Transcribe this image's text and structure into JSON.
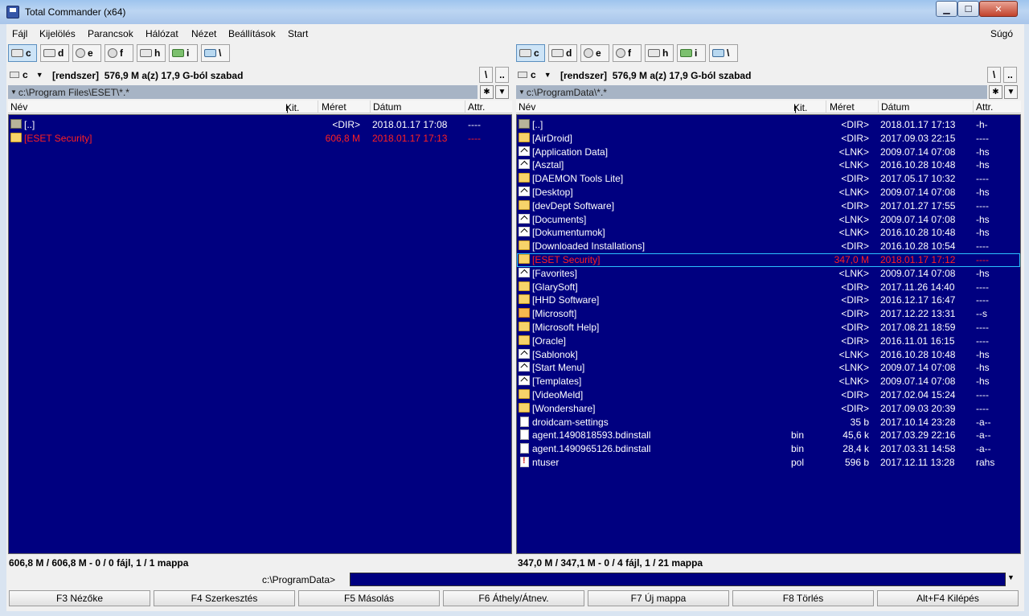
{
  "window": {
    "title": "Total Commander (x64)",
    "min_glyph": "▁",
    "max_glyph": "☐",
    "close_glyph": "✕"
  },
  "menu": {
    "items": [
      "Fájl",
      "Kijelölés",
      "Parancsok",
      "Hálózat",
      "Nézet",
      "Beállítások",
      "Start"
    ],
    "help": "Súgó"
  },
  "drives": [
    "c",
    "d",
    "e",
    "f",
    "h",
    "i",
    "\\"
  ],
  "left": {
    "drive": "c",
    "drive_label": "[rendszer]",
    "free_space": "576,9 M a(z) 17,9 G-ból szabad",
    "root_label": "\\",
    "up_label": "..",
    "path": "c:\\Program Files\\ESET\\*.*",
    "status": "606,8 M / 606,8 M - 0 / 0 fájl, 1 / 1 mappa",
    "rows": [
      {
        "icon": "up",
        "name": "[..]",
        "ext": "",
        "size": "<DIR>",
        "date": "2018.01.17 17:08",
        "attr": "----",
        "red": false
      },
      {
        "icon": "folder",
        "name": "[ESET Security]",
        "ext": "",
        "size": "606,8 M",
        "date": "2018.01.17 17:13",
        "attr": "----",
        "red": true
      }
    ]
  },
  "right": {
    "drive": "c",
    "drive_label": "[rendszer]",
    "free_space": "576,9 M a(z) 17,9 G-ból szabad",
    "root_label": "\\",
    "up_label": "..",
    "path": "c:\\ProgramData\\*.*",
    "status": "347,0 M / 347,1 M - 0 / 4 fájl, 1 / 21 mappa",
    "rows": [
      {
        "icon": "up",
        "name": "[..]",
        "ext": "",
        "size": "<DIR>",
        "date": "2018.01.17 17:13",
        "attr": "-h-",
        "red": false
      },
      {
        "icon": "folder",
        "name": "[AirDroid]",
        "ext": "",
        "size": "<DIR>",
        "date": "2017.09.03 22:15",
        "attr": "----",
        "red": false
      },
      {
        "icon": "link",
        "name": "[Application Data]",
        "ext": "",
        "size": "<LNK>",
        "date": "2009.07.14 07:08",
        "attr": "-hs",
        "red": false
      },
      {
        "icon": "link",
        "name": "[Asztal]",
        "ext": "",
        "size": "<LNK>",
        "date": "2016.10.28 10:48",
        "attr": "-hs",
        "red": false
      },
      {
        "icon": "folder",
        "name": "[DAEMON Tools Lite]",
        "ext": "",
        "size": "<DIR>",
        "date": "2017.05.17 10:32",
        "attr": "----",
        "red": false
      },
      {
        "icon": "link",
        "name": "[Desktop]",
        "ext": "",
        "size": "<LNK>",
        "date": "2009.07.14 07:08",
        "attr": "-hs",
        "red": false
      },
      {
        "icon": "folder",
        "name": "[devDept Software]",
        "ext": "",
        "size": "<DIR>",
        "date": "2017.01.27 17:55",
        "attr": "----",
        "red": false
      },
      {
        "icon": "link",
        "name": "[Documents]",
        "ext": "",
        "size": "<LNK>",
        "date": "2009.07.14 07:08",
        "attr": "-hs",
        "red": false
      },
      {
        "icon": "link",
        "name": "[Dokumentumok]",
        "ext": "",
        "size": "<LNK>",
        "date": "2016.10.28 10:48",
        "attr": "-hs",
        "red": false
      },
      {
        "icon": "folder",
        "name": "[Downloaded Installations]",
        "ext": "",
        "size": "<DIR>",
        "date": "2016.10.28 10:54",
        "attr": "----",
        "red": false
      },
      {
        "icon": "folder",
        "name": "[ESET Security]",
        "ext": "",
        "size": "347,0 M",
        "date": "2018.01.17 17:12",
        "attr": "----",
        "red": true,
        "cursor": true
      },
      {
        "icon": "link",
        "name": "[Favorites]",
        "ext": "",
        "size": "<LNK>",
        "date": "2009.07.14 07:08",
        "attr": "-hs",
        "red": false
      },
      {
        "icon": "folder",
        "name": "[GlarySoft]",
        "ext": "",
        "size": "<DIR>",
        "date": "2017.11.26 14:40",
        "attr": "----",
        "red": false
      },
      {
        "icon": "folder",
        "name": "[HHD Software]",
        "ext": "",
        "size": "<DIR>",
        "date": "2016.12.17 16:47",
        "attr": "----",
        "red": false
      },
      {
        "icon": "warn",
        "name": "[Microsoft]",
        "ext": "",
        "size": "<DIR>",
        "date": "2017.12.22 13:31",
        "attr": "--s",
        "red": false
      },
      {
        "icon": "folder",
        "name": "[Microsoft Help]",
        "ext": "",
        "size": "<DIR>",
        "date": "2017.08.21 18:59",
        "attr": "----",
        "red": false
      },
      {
        "icon": "folder",
        "name": "[Oracle]",
        "ext": "",
        "size": "<DIR>",
        "date": "2016.11.01 16:15",
        "attr": "----",
        "red": false
      },
      {
        "icon": "link",
        "name": "[Sablonok]",
        "ext": "",
        "size": "<LNK>",
        "date": "2016.10.28 10:48",
        "attr": "-hs",
        "red": false
      },
      {
        "icon": "link",
        "name": "[Start Menu]",
        "ext": "",
        "size": "<LNK>",
        "date": "2009.07.14 07:08",
        "attr": "-hs",
        "red": false
      },
      {
        "icon": "link",
        "name": "[Templates]",
        "ext": "",
        "size": "<LNK>",
        "date": "2009.07.14 07:08",
        "attr": "-hs",
        "red": false
      },
      {
        "icon": "folder",
        "name": "[VideoMeld]",
        "ext": "",
        "size": "<DIR>",
        "date": "2017.02.04 15:24",
        "attr": "----",
        "red": false
      },
      {
        "icon": "folder",
        "name": "[Wondershare]",
        "ext": "",
        "size": "<DIR>",
        "date": "2017.09.03 20:39",
        "attr": "----",
        "red": false
      },
      {
        "icon": "file",
        "name": "droidcam-settings",
        "ext": "",
        "size": "35 b",
        "date": "2017.10.14 23:28",
        "attr": "-a--",
        "red": false
      },
      {
        "icon": "file",
        "name": "agent.1490818593.bdinstall",
        "ext": "bin",
        "size": "45,6 k",
        "date": "2017.03.29 22:16",
        "attr": "-a--",
        "red": false
      },
      {
        "icon": "file",
        "name": "agent.1490965126.bdinstall",
        "ext": "bin",
        "size": "28,4 k",
        "date": "2017.03.31 14:58",
        "attr": "-a--",
        "red": false
      },
      {
        "icon": "sys",
        "name": "ntuser",
        "ext": "pol",
        "size": "596 b",
        "date": "2017.12.11 13:28",
        "attr": "rahs",
        "red": false
      }
    ]
  },
  "columns": {
    "name": "Név",
    "ext": "Kit.",
    "size": "Méret",
    "date": "Dátum",
    "attr": "Attr.",
    "sort_glyph": "🠕"
  },
  "command_line": {
    "label": "c:\\ProgramData>",
    "value": ""
  },
  "fkeys": [
    "F3 Nézőke",
    "F4 Szerkesztés",
    "F5 Másolás",
    "F6 Áthely/Átnev.",
    "F7 Új mappa",
    "F8 Törlés",
    "Alt+F4 Kilépés"
  ],
  "colors": {
    "panel_bg": "#000080",
    "selected_text": "#ff2020",
    "normal_text": "#ffffff",
    "cursor_outline": "#2bc1ff"
  }
}
